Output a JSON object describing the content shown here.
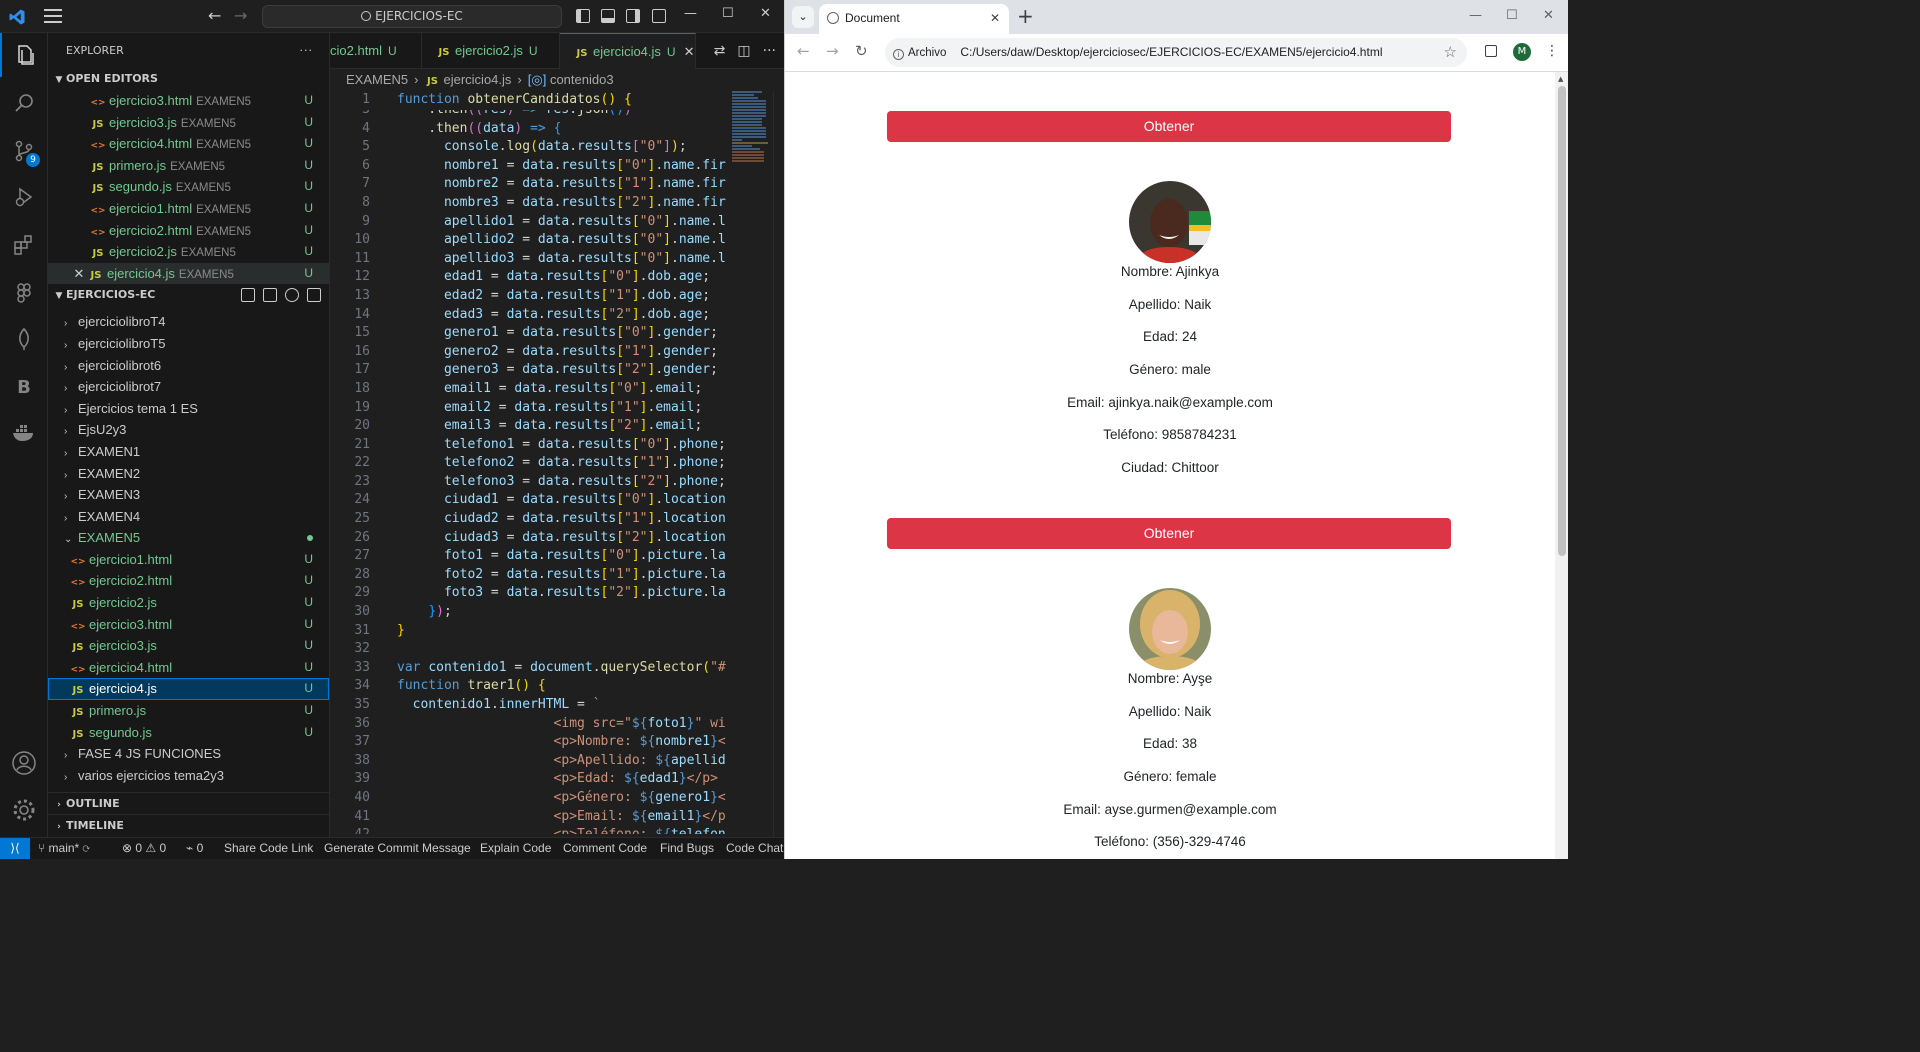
{
  "vscode": {
    "search_text": "EJERCICIOS-EC",
    "explorer_title": "EXPLORER",
    "explorer_more": "···",
    "scm_badge": "9",
    "open_editors_title": "OPEN EDITORS",
    "open_editors": [
      {
        "name": "ejercicio3.html",
        "folder": "EXAMEN5",
        "type": "html",
        "status": "U"
      },
      {
        "name": "ejercicio3.js",
        "folder": "EXAMEN5",
        "type": "js",
        "status": "U"
      },
      {
        "name": "ejercicio4.html",
        "folder": "EXAMEN5",
        "type": "html",
        "status": "U"
      },
      {
        "name": "primero.js",
        "folder": "EXAMEN5",
        "type": "js",
        "status": "U"
      },
      {
        "name": "segundo.js",
        "folder": "EXAMEN5",
        "type": "js",
        "status": "U"
      },
      {
        "name": "ejercicio1.html",
        "folder": "EXAMEN5",
        "type": "html",
        "status": "U"
      },
      {
        "name": "ejercicio2.html",
        "folder": "EXAMEN5",
        "type": "html",
        "status": "U"
      },
      {
        "name": "ejercicio2.js",
        "folder": "EXAMEN5",
        "type": "js",
        "status": "U"
      },
      {
        "name": "ejercicio4.js",
        "folder": "EXAMEN5",
        "type": "js",
        "status": "U"
      }
    ],
    "workspace_title": "EJERCICIOS-EC",
    "folders_top": [
      "ejerciciolibroT4",
      "ejerciciolibroT5",
      "ejerciciolibrot6",
      "ejerciciolibrot7",
      "Ejercicios tema 1 ES",
      "EjsU2y3",
      "EXAMEN1",
      "EXAMEN2",
      "EXAMEN3",
      "EXAMEN4"
    ],
    "examen5_label": "EXAMEN5",
    "examen5_files": [
      {
        "name": "ejercicio1.html",
        "type": "html",
        "status": "U"
      },
      {
        "name": "ejercicio2.html",
        "type": "html",
        "status": "U"
      },
      {
        "name": "ejercicio2.js",
        "type": "js",
        "status": "U"
      },
      {
        "name": "ejercicio3.html",
        "type": "html",
        "status": "U"
      },
      {
        "name": "ejercicio3.js",
        "type": "js",
        "status": "U"
      },
      {
        "name": "ejercicio4.html",
        "type": "html",
        "status": "U"
      },
      {
        "name": "ejercicio4.js",
        "type": "js",
        "status": "U"
      },
      {
        "name": "primero.js",
        "type": "js",
        "status": "U"
      },
      {
        "name": "segundo.js",
        "type": "js",
        "status": "U"
      }
    ],
    "folders_bottom": [
      "FASE 4 JS FUNCIONES",
      "varios ejercicios tema2y3"
    ],
    "outline_title": "OUTLINE",
    "timeline_title": "TIMELINE",
    "tabs": [
      {
        "label": "cio2.html",
        "status": "U"
      },
      {
        "label": "ejercicio2.js",
        "status": "U"
      },
      {
        "label": "ejercicio4.js",
        "status": "U"
      }
    ],
    "breadcrumb": [
      "EXAMEN5",
      "ejercicio4.js",
      "contenido3"
    ],
    "status_bar": {
      "branch": "main*",
      "problems": "⊗ 0 ⚠ 0",
      "ports": "0",
      "items": [
        "Share Code Link",
        "Generate Commit Message",
        "Explain Code",
        "Comment Code",
        "Find Bugs",
        "Code Chat"
      ]
    }
  },
  "browser": {
    "tab_title": "Document",
    "address_chip": "Archivo",
    "url": "C:/Users/daw/Desktop/ejerciciosec/EJERCICIOS-EC/EXAMEN5/ejercicio4.html",
    "avatar_letter": "M",
    "button_label": "Obtener",
    "candidates": [
      {
        "nombre": "Nombre: Ajinkya",
        "apellido": "Apellido: Naik",
        "edad": "Edad: 24",
        "genero": "Género: male",
        "email": "Email: ajinkya.naik@example.com",
        "telefono": "Teléfono: 9858784231",
        "ciudad": "Ciudad: Chittoor"
      },
      {
        "nombre": "Nombre: Ayşe",
        "apellido": "Apellido: Naik",
        "edad": "Edad: 38",
        "genero": "Género: female",
        "email": "Email: ayse.gurmen@example.com",
        "telefono": "Teléfono: (356)-329-4746"
      }
    ]
  },
  "colors": {
    "accent": "#0078d4",
    "button_red": "#dc3545",
    "git_untracked": "#73c991"
  }
}
